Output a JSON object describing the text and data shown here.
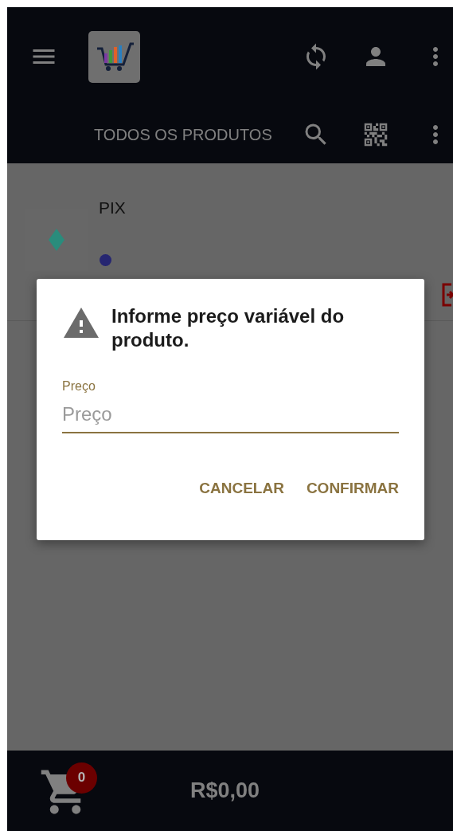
{
  "sub_bar": {
    "title": "TODOS OS PRODUTOS"
  },
  "products": [
    {
      "name": "PIX"
    }
  ],
  "dialog": {
    "title": "Informe preço variável do produto.",
    "field": {
      "label": "Preço",
      "placeholder": "Preço"
    },
    "buttons": [
      "CANCELAR",
      "CONFIRMAR"
    ]
  },
  "cart": {
    "count": "0",
    "total": "R$0,00"
  }
}
